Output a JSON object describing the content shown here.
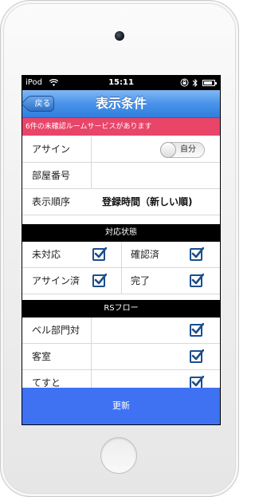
{
  "status_bar": {
    "carrier": "iPod",
    "time": "15:11",
    "battery_level": 0.85
  },
  "nav": {
    "back_label": "戻る",
    "title": "表示条件"
  },
  "notice": "6件の未確認ルームサービスがあります",
  "form": {
    "assign": {
      "label": "アサイン",
      "toggle_text": "自分",
      "toggle_on": false
    },
    "room_number": {
      "label": "部屋番号",
      "value": ""
    },
    "sort_order": {
      "label": "表示順序",
      "value": "登録時間（新しい順)"
    }
  },
  "status_section": {
    "header": "対応状態",
    "items": [
      {
        "label": "未対応",
        "checked": true
      },
      {
        "label": "確認済",
        "checked": true
      },
      {
        "label": "アサイン済",
        "checked": true
      },
      {
        "label": "完了",
        "checked": true
      }
    ]
  },
  "flow_section": {
    "header": "RSフロー",
    "items": [
      {
        "label": "ベル部門対",
        "checked": true
      },
      {
        "label": "客室",
        "checked": true
      },
      {
        "label": "てすと",
        "checked": true
      }
    ]
  },
  "update_label": "更新",
  "colors": {
    "nav_blue": "#3d8be8",
    "notice_pink": "#e84569",
    "update_blue": "#3e72f3",
    "checkbox_border": "#1c4e8c"
  }
}
